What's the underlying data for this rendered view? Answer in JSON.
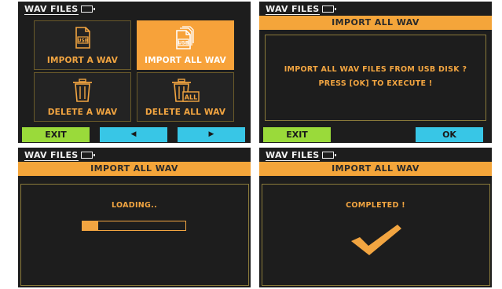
{
  "header": {
    "title": "WAV FILES"
  },
  "menu": {
    "tiles": [
      {
        "label": "IMPORT A WAV",
        "icon": "usb-file-icon",
        "badge": "USB",
        "selected": false
      },
      {
        "label": "IMPORT ALL WAV",
        "icon": "usb-files-icon",
        "badge": "USB",
        "selected": true
      },
      {
        "label": "DELETE A WAV",
        "icon": "trash-icon",
        "selected": false
      },
      {
        "label": "DELETE ALL WAV",
        "icon": "trash-all-icon",
        "badge": "ALL",
        "selected": false
      }
    ],
    "softkeys": [
      {
        "label": "EXIT",
        "color": "#9ada3a"
      },
      {
        "label": "◀",
        "color": "#38c6e6"
      },
      {
        "label": "▶",
        "color": "#38c6e6"
      }
    ]
  },
  "confirm": {
    "title": "IMPORT ALL WAV",
    "line1": "IMPORT ALL WAV FILES FROM USB DISK ?",
    "line2": "PRESS [OK] TO EXECUTE !",
    "softkeys": [
      {
        "label": "EXIT",
        "color": "#9ada3a"
      },
      {
        "label": "OK",
        "color": "#38c6e6"
      }
    ]
  },
  "loading": {
    "title": "IMPORT ALL WAV",
    "status": "LOADING..",
    "progress": 0.15
  },
  "complete": {
    "title": "IMPORT ALL WAV",
    "status": "COMPLETED !",
    "icon": "checkmark-icon"
  },
  "colors": {
    "accent": "#f4a53a",
    "text_accent": "#f2a541",
    "background": "#1d1d1d"
  }
}
